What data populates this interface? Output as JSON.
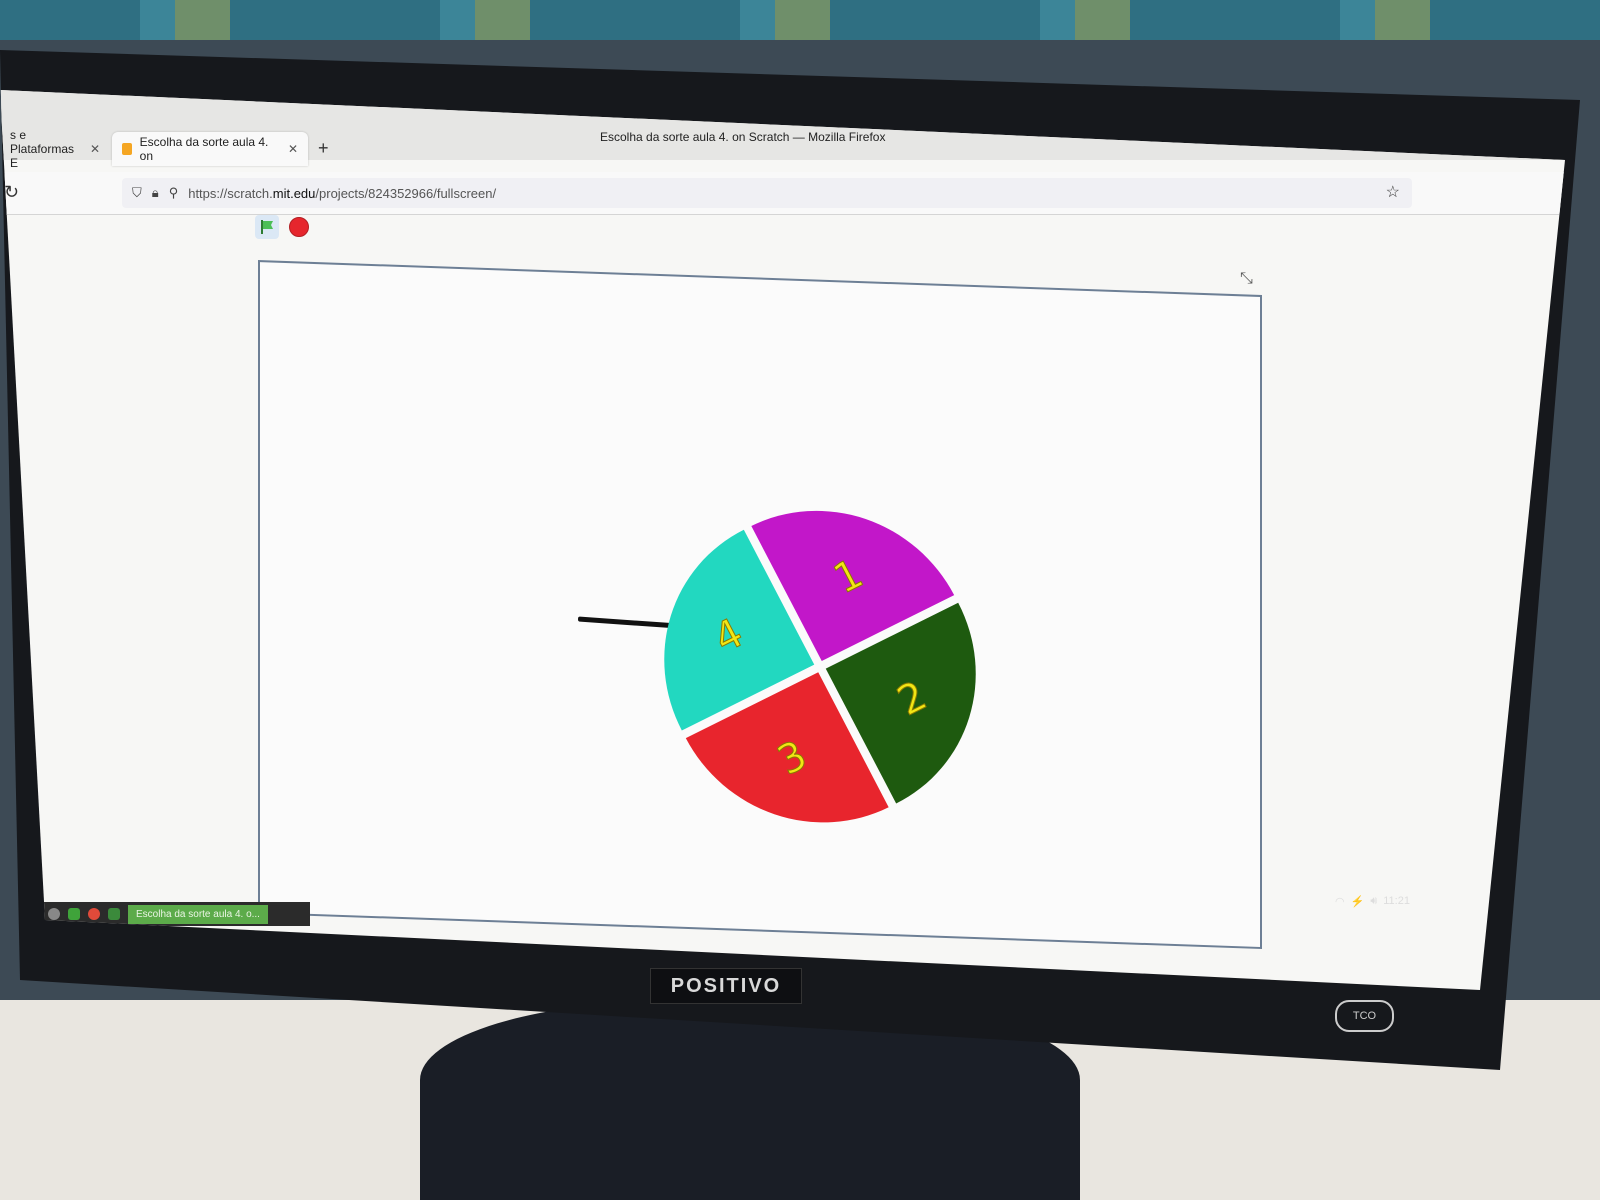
{
  "browser": {
    "window_title": "Escolha da sorte aula 4. on Scratch — Mozilla Firefox",
    "tabs": [
      {
        "label": "s e Plataformas E",
        "active": false
      },
      {
        "label": "Escolha da sorte aula 4. on",
        "active": true
      }
    ],
    "url_prefix": "https://scratch.",
    "url_host": "mit.edu",
    "url_path": "/projects/824352966/fullscreen/"
  },
  "scratch": {
    "wheel": [
      {
        "label": "1",
        "color": "#c217c9"
      },
      {
        "label": "2",
        "color": "#1e5a0f"
      },
      {
        "label": "3",
        "color": "#e8252d"
      },
      {
        "label": "4",
        "color": "#22d8c0"
      }
    ],
    "label_color": "#f2e614"
  },
  "taskbar": {
    "task_label": "Escolha da sorte aula 4. o..."
  },
  "tray": {
    "time": "11:21"
  },
  "monitor": {
    "brand": "POSITIVO",
    "badge": "TCO"
  }
}
